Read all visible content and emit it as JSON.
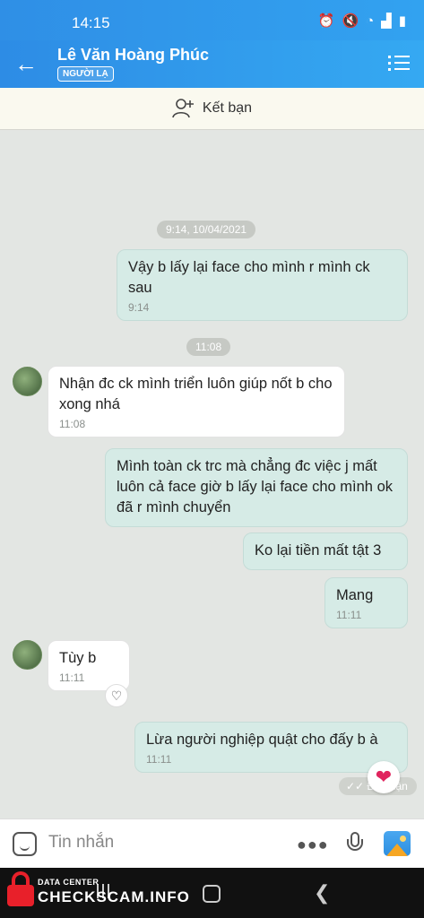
{
  "status_bar": {
    "time": "14:15",
    "icons": [
      "alarm-icon",
      "mute-icon",
      "wifi-icon",
      "signal-icon",
      "battery-icon"
    ]
  },
  "header": {
    "name": "Lê Văn Hoàng Phúc",
    "badge": "NGƯỜI LẠ"
  },
  "friend_bar": {
    "label": "Kết bạn"
  },
  "messages": [
    {
      "type": "timestamp",
      "text": "9:14, 10/04/2021"
    },
    {
      "type": "sent",
      "text": "Vậy b lấy lại face cho mình r mình ck sau",
      "time": "9:14"
    },
    {
      "type": "timestamp",
      "text": "11:08"
    },
    {
      "type": "received",
      "text": "Nhận đc ck mình triển luôn giúp nốt b cho xong nhá",
      "time": "11:08"
    },
    {
      "type": "sent",
      "text": "Mình toàn ck trc mà chẳng đc việc j mất luôn cả face giờ b lấy lại face cho mình ok đã r mình chuyển",
      "time": ""
    },
    {
      "type": "sent",
      "text": "Ko lại tiền mất tật 3",
      "time": ""
    },
    {
      "type": "sent",
      "text": "Mang",
      "time": "11:11"
    },
    {
      "type": "received",
      "text": "Tùy b",
      "time": "11:11"
    },
    {
      "type": "sent",
      "text": "Lừa người nghiệp quật cho đấy b à",
      "time": "11:11"
    }
  ],
  "read_status": "Đã nhận",
  "input": {
    "placeholder": "Tin nhắn"
  },
  "watermark": {
    "small": "DATA CENTER",
    "big": "CHECKSCAM.INFO"
  },
  "colors": {
    "header": "#2f8fe6",
    "sent_bubble": "#d6ebe6",
    "received_bubble": "#ffffff",
    "chat_bg": "#e3e6e3",
    "heart": "#e0245e"
  }
}
